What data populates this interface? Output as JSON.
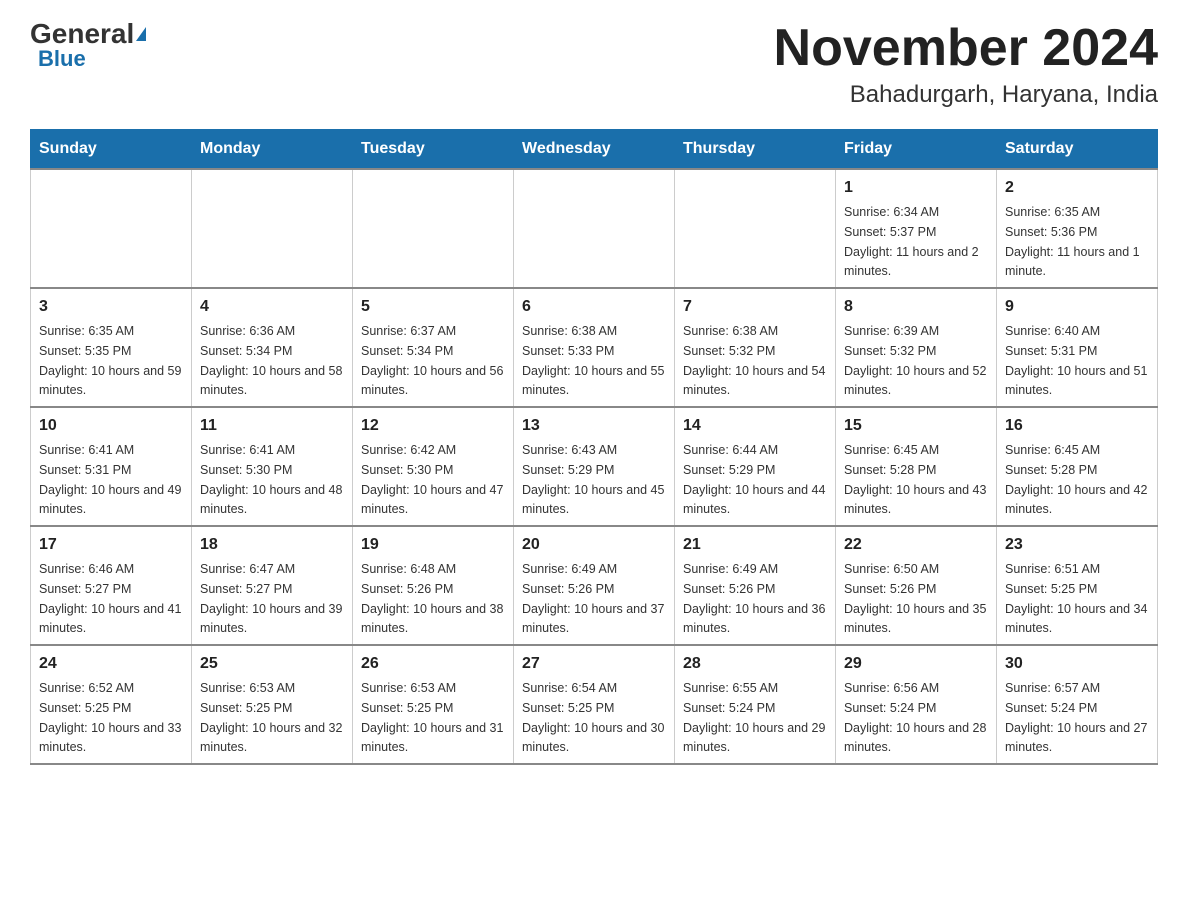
{
  "header": {
    "logo_general": "General",
    "logo_blue": "Blue",
    "month_title": "November 2024",
    "location": "Bahadurgarh, Haryana, India"
  },
  "weekdays": [
    "Sunday",
    "Monday",
    "Tuesday",
    "Wednesday",
    "Thursday",
    "Friday",
    "Saturday"
  ],
  "weeks": [
    [
      {
        "day": "",
        "info": ""
      },
      {
        "day": "",
        "info": ""
      },
      {
        "day": "",
        "info": ""
      },
      {
        "day": "",
        "info": ""
      },
      {
        "day": "",
        "info": ""
      },
      {
        "day": "1",
        "info": "Sunrise: 6:34 AM\nSunset: 5:37 PM\nDaylight: 11 hours and 2 minutes."
      },
      {
        "day": "2",
        "info": "Sunrise: 6:35 AM\nSunset: 5:36 PM\nDaylight: 11 hours and 1 minute."
      }
    ],
    [
      {
        "day": "3",
        "info": "Sunrise: 6:35 AM\nSunset: 5:35 PM\nDaylight: 10 hours and 59 minutes."
      },
      {
        "day": "4",
        "info": "Sunrise: 6:36 AM\nSunset: 5:34 PM\nDaylight: 10 hours and 58 minutes."
      },
      {
        "day": "5",
        "info": "Sunrise: 6:37 AM\nSunset: 5:34 PM\nDaylight: 10 hours and 56 minutes."
      },
      {
        "day": "6",
        "info": "Sunrise: 6:38 AM\nSunset: 5:33 PM\nDaylight: 10 hours and 55 minutes."
      },
      {
        "day": "7",
        "info": "Sunrise: 6:38 AM\nSunset: 5:32 PM\nDaylight: 10 hours and 54 minutes."
      },
      {
        "day": "8",
        "info": "Sunrise: 6:39 AM\nSunset: 5:32 PM\nDaylight: 10 hours and 52 minutes."
      },
      {
        "day": "9",
        "info": "Sunrise: 6:40 AM\nSunset: 5:31 PM\nDaylight: 10 hours and 51 minutes."
      }
    ],
    [
      {
        "day": "10",
        "info": "Sunrise: 6:41 AM\nSunset: 5:31 PM\nDaylight: 10 hours and 49 minutes."
      },
      {
        "day": "11",
        "info": "Sunrise: 6:41 AM\nSunset: 5:30 PM\nDaylight: 10 hours and 48 minutes."
      },
      {
        "day": "12",
        "info": "Sunrise: 6:42 AM\nSunset: 5:30 PM\nDaylight: 10 hours and 47 minutes."
      },
      {
        "day": "13",
        "info": "Sunrise: 6:43 AM\nSunset: 5:29 PM\nDaylight: 10 hours and 45 minutes."
      },
      {
        "day": "14",
        "info": "Sunrise: 6:44 AM\nSunset: 5:29 PM\nDaylight: 10 hours and 44 minutes."
      },
      {
        "day": "15",
        "info": "Sunrise: 6:45 AM\nSunset: 5:28 PM\nDaylight: 10 hours and 43 minutes."
      },
      {
        "day": "16",
        "info": "Sunrise: 6:45 AM\nSunset: 5:28 PM\nDaylight: 10 hours and 42 minutes."
      }
    ],
    [
      {
        "day": "17",
        "info": "Sunrise: 6:46 AM\nSunset: 5:27 PM\nDaylight: 10 hours and 41 minutes."
      },
      {
        "day": "18",
        "info": "Sunrise: 6:47 AM\nSunset: 5:27 PM\nDaylight: 10 hours and 39 minutes."
      },
      {
        "day": "19",
        "info": "Sunrise: 6:48 AM\nSunset: 5:26 PM\nDaylight: 10 hours and 38 minutes."
      },
      {
        "day": "20",
        "info": "Sunrise: 6:49 AM\nSunset: 5:26 PM\nDaylight: 10 hours and 37 minutes."
      },
      {
        "day": "21",
        "info": "Sunrise: 6:49 AM\nSunset: 5:26 PM\nDaylight: 10 hours and 36 minutes."
      },
      {
        "day": "22",
        "info": "Sunrise: 6:50 AM\nSunset: 5:26 PM\nDaylight: 10 hours and 35 minutes."
      },
      {
        "day": "23",
        "info": "Sunrise: 6:51 AM\nSunset: 5:25 PM\nDaylight: 10 hours and 34 minutes."
      }
    ],
    [
      {
        "day": "24",
        "info": "Sunrise: 6:52 AM\nSunset: 5:25 PM\nDaylight: 10 hours and 33 minutes."
      },
      {
        "day": "25",
        "info": "Sunrise: 6:53 AM\nSunset: 5:25 PM\nDaylight: 10 hours and 32 minutes."
      },
      {
        "day": "26",
        "info": "Sunrise: 6:53 AM\nSunset: 5:25 PM\nDaylight: 10 hours and 31 minutes."
      },
      {
        "day": "27",
        "info": "Sunrise: 6:54 AM\nSunset: 5:25 PM\nDaylight: 10 hours and 30 minutes."
      },
      {
        "day": "28",
        "info": "Sunrise: 6:55 AM\nSunset: 5:24 PM\nDaylight: 10 hours and 29 minutes."
      },
      {
        "day": "29",
        "info": "Sunrise: 6:56 AM\nSunset: 5:24 PM\nDaylight: 10 hours and 28 minutes."
      },
      {
        "day": "30",
        "info": "Sunrise: 6:57 AM\nSunset: 5:24 PM\nDaylight: 10 hours and 27 minutes."
      }
    ]
  ]
}
